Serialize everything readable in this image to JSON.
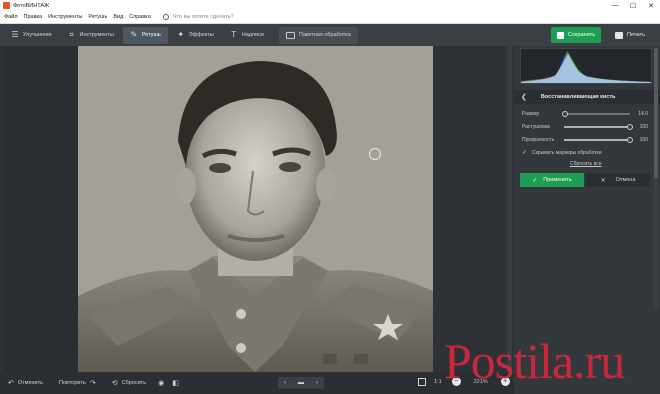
{
  "window": {
    "title": "ФотоВИНТАЖ",
    "controls": {
      "minimize": "—",
      "maximize": "☐",
      "close": "✕"
    }
  },
  "menu": {
    "items": [
      "Файл",
      "Правка",
      "Инструменты",
      "Ретушь",
      "Вид",
      "Справка"
    ],
    "search_placeholder": "Что вы хотите сделать?"
  },
  "toolbar": {
    "tabs": [
      {
        "label": "Улучшения",
        "icon": "sliders-icon"
      },
      {
        "label": "Инструменты",
        "icon": "crop-icon"
      },
      {
        "label": "Ретушь",
        "icon": "brush-icon",
        "active": true
      },
      {
        "label": "Эффекты",
        "icon": "magic-wand-icon"
      },
      {
        "label": "Надписи",
        "icon": "text-icon"
      }
    ],
    "batch_label": "Пакетная обработка",
    "save_label": "Сохранить",
    "print_label": "Печать"
  },
  "panel": {
    "title": "Восстанавливающая кисть",
    "sliders": [
      {
        "label": "Размер",
        "value": "14,0",
        "fraction": 0.02
      },
      {
        "label": "Растушевка",
        "value": "100",
        "fraction": 1.0
      },
      {
        "label": "Прозрачность",
        "value": "100",
        "fraction": 1.0
      }
    ],
    "checkbox_label": "Скрывать маркеры обработки",
    "checkbox_checked": true,
    "reset_all": "Сбросить все",
    "apply_label": "Применить",
    "cancel_label": "Отмена"
  },
  "statusbar": {
    "undo_label": "Отменить",
    "redo_label": "Повторить",
    "reset_label": "Сбросить",
    "zoom_value": "221%"
  },
  "watermark": "Postila.ru",
  "colors": {
    "accent_green": "#1e9e52",
    "active_tab": "#4d5863",
    "watermark_red": "#c8283a"
  }
}
